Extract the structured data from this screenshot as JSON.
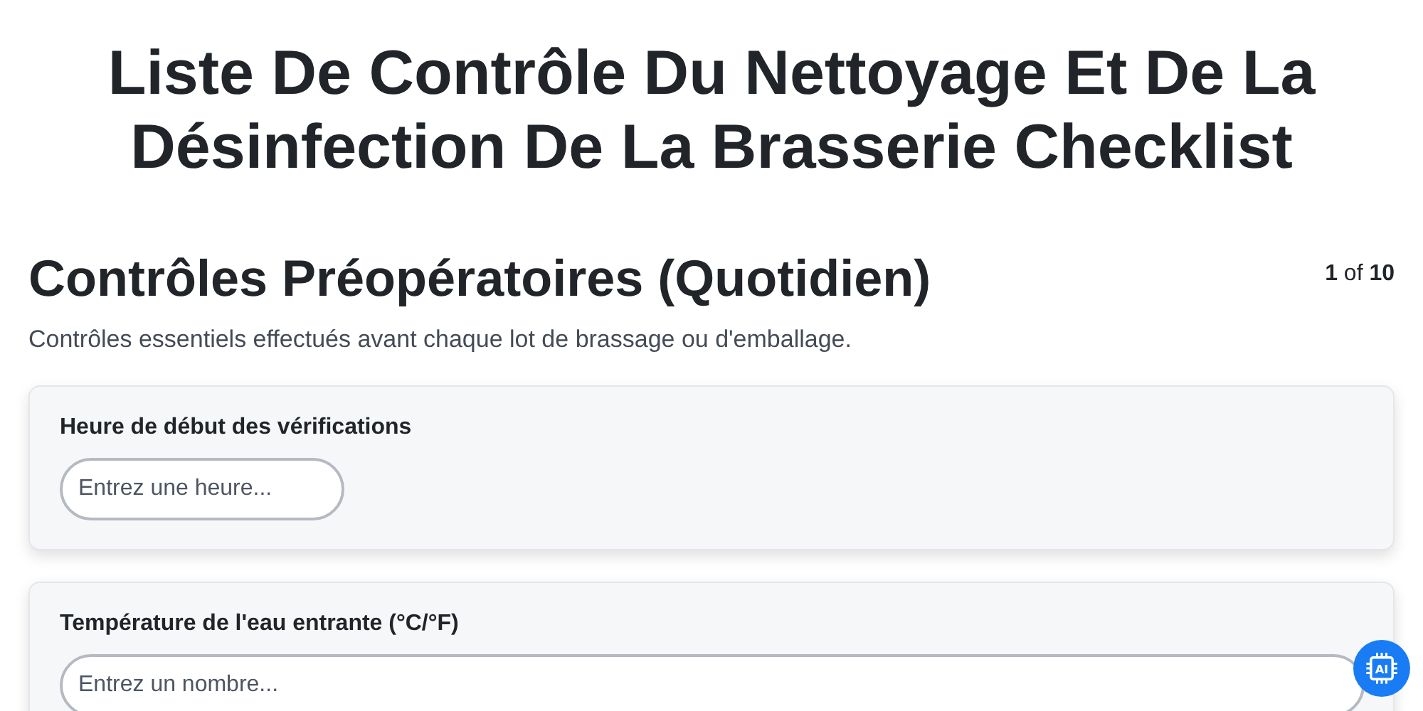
{
  "title": "Liste De Contrôle Du Nettoyage Et De La Désinfection De La Brasserie Checklist",
  "section": {
    "heading": "Contrôles Préopératoires (Quotidien)",
    "page_indicator": "**1** of **10**",
    "description": "Contrôles essentiels effectués avant chaque lot de brassage ou d'emballage."
  },
  "questions": [
    {
      "label": "Heure de début des vérifications",
      "kind": "time",
      "placeholder": "Entrez une heure..."
    },
    {
      "label": "Température de l'eau entrante (°C/°F)",
      "kind": "number",
      "placeholder": "Entrez un nombre..."
    }
  ],
  "assistant_badge": "AI"
}
